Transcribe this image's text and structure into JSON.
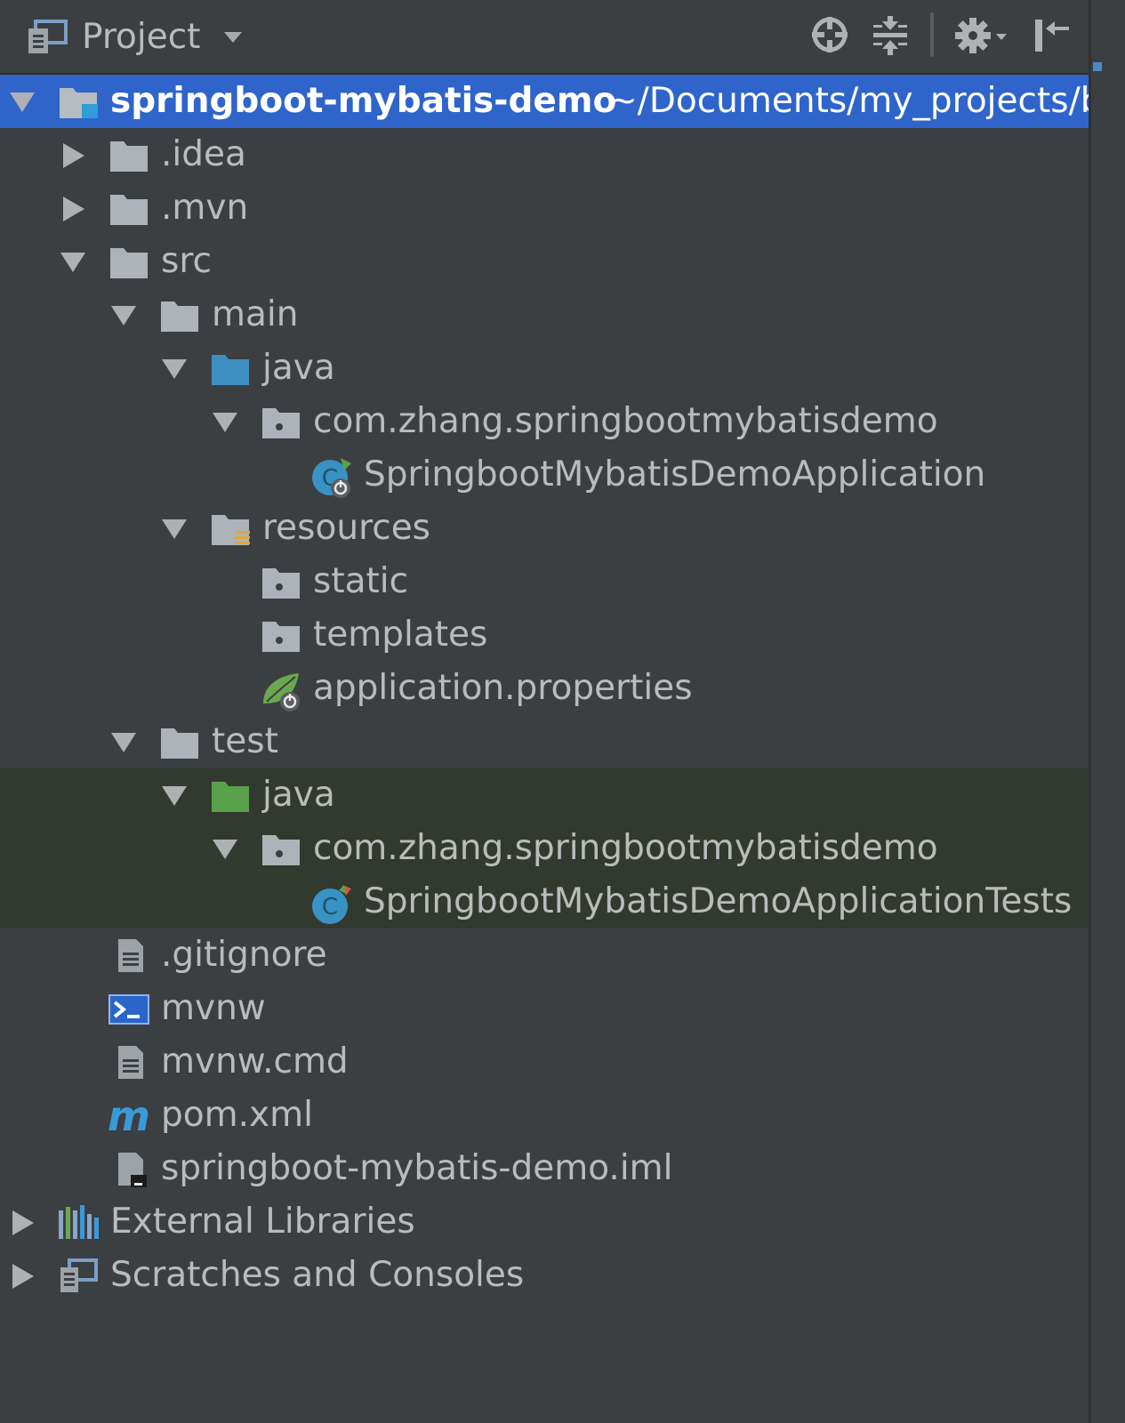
{
  "header": {
    "title": "Project",
    "icons": [
      "project-view-icon",
      "chevron-down-icon",
      "locate-icon",
      "collapse-all-icon",
      "gear-icon",
      "hide-panel-icon"
    ]
  },
  "tree": [
    {
      "label": "springboot-mybatis-demo",
      "path": "~/Documents/my_projects/b",
      "indent": 0,
      "arrow": "down",
      "icon": "module-folder-icon",
      "selected": true
    },
    {
      "label": ".idea",
      "indent": 1,
      "arrow": "right",
      "icon": "folder-icon"
    },
    {
      "label": ".mvn",
      "indent": 1,
      "arrow": "right",
      "icon": "folder-icon"
    },
    {
      "label": "src",
      "indent": 1,
      "arrow": "down",
      "icon": "folder-icon"
    },
    {
      "label": "main",
      "indent": 2,
      "arrow": "down",
      "icon": "folder-icon"
    },
    {
      "label": "java",
      "indent": 3,
      "arrow": "down",
      "icon": "source-folder-icon"
    },
    {
      "label": "com.zhang.springbootmybatisdemo",
      "indent": 4,
      "arrow": "down",
      "icon": "package-icon"
    },
    {
      "label": "SpringbootMybatisDemoApplication",
      "indent": 5,
      "arrow": "none",
      "icon": "spring-boot-class-icon"
    },
    {
      "label": "resources",
      "indent": 3,
      "arrow": "down",
      "icon": "resources-folder-icon"
    },
    {
      "label": "static",
      "indent": 4,
      "arrow": "none",
      "icon": "package-icon"
    },
    {
      "label": "templates",
      "indent": 4,
      "arrow": "none",
      "icon": "package-icon"
    },
    {
      "label": "application.properties",
      "indent": 4,
      "arrow": "none",
      "icon": "spring-properties-icon"
    },
    {
      "label": "test",
      "indent": 2,
      "arrow": "down",
      "icon": "folder-icon"
    },
    {
      "label": "java",
      "indent": 3,
      "arrow": "down",
      "icon": "test-source-folder-icon",
      "test": true
    },
    {
      "label": "com.zhang.springbootmybatisdemo",
      "indent": 4,
      "arrow": "down",
      "icon": "package-icon",
      "test": true
    },
    {
      "label": "SpringbootMybatisDemoApplicationTests",
      "indent": 5,
      "arrow": "none",
      "icon": "test-class-icon",
      "test": true
    },
    {
      "label": ".gitignore",
      "indent": 1,
      "arrow": "none",
      "icon": "text-file-icon"
    },
    {
      "label": "mvnw",
      "indent": 1,
      "arrow": "none",
      "icon": "shell-script-icon"
    },
    {
      "label": "mvnw.cmd",
      "indent": 1,
      "arrow": "none",
      "icon": "text-file-icon"
    },
    {
      "label": "pom.xml",
      "indent": 1,
      "arrow": "none",
      "icon": "maven-icon"
    },
    {
      "label": "springboot-mybatis-demo.iml",
      "indent": 1,
      "arrow": "none",
      "icon": "iml-file-icon"
    },
    {
      "label": "External Libraries",
      "indent": 0,
      "arrow": "right",
      "icon": "libraries-icon"
    },
    {
      "label": "Scratches and Consoles",
      "indent": 0,
      "arrow": "right",
      "icon": "scratches-icon"
    }
  ],
  "colors": {
    "background": "#3c3f41",
    "selection": "#2f65ca",
    "test_row": "#32392f",
    "text": "#bbbbbb",
    "folder": "#aeb3b9",
    "source_folder": "#3d8fc1",
    "test_folder": "#59a14b"
  }
}
